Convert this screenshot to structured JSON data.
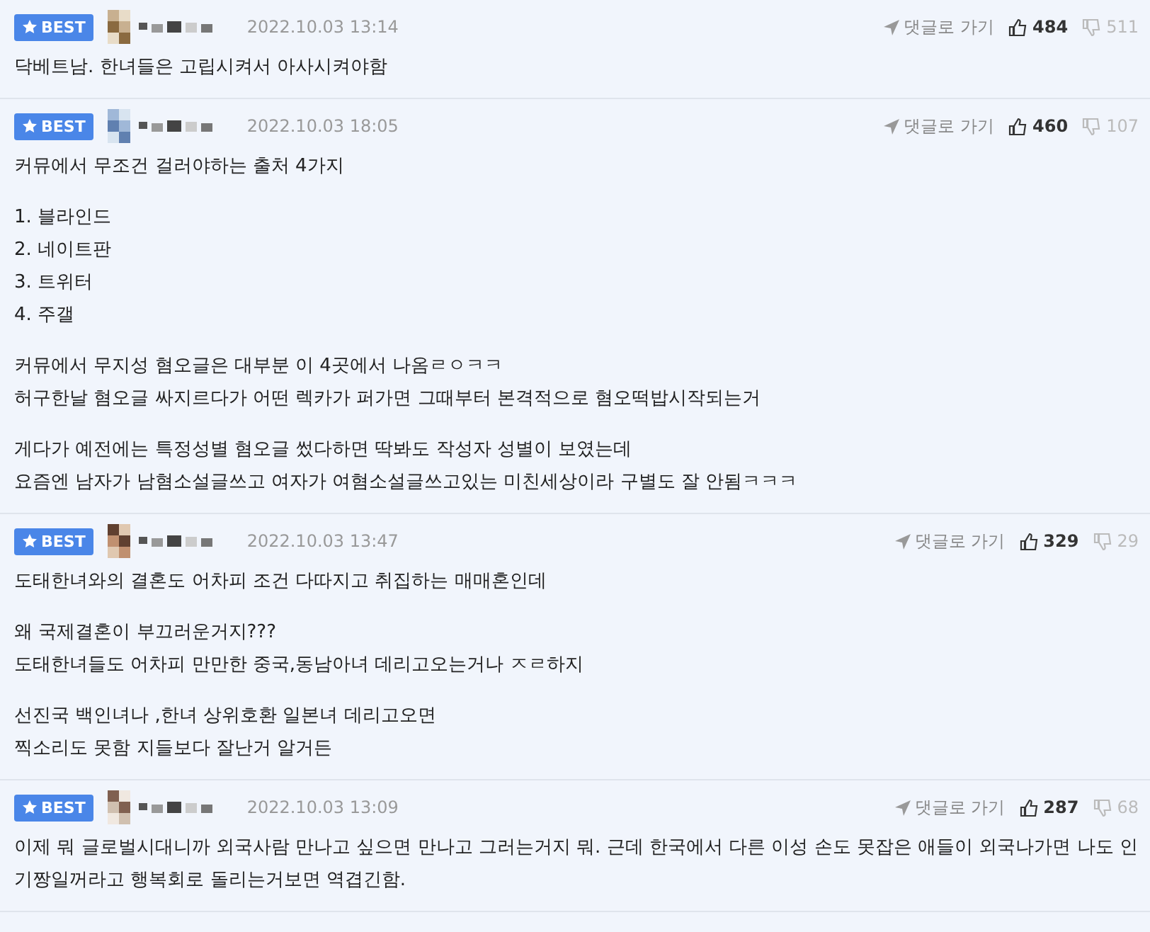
{
  "comments": [
    {
      "badge": "BEST",
      "date": "2022.10.03 13:14",
      "reply_label": "댓글로 가기",
      "likes": "484",
      "dislikes": "511",
      "paragraphs": [
        [
          "닥베트남. 한녀들은 고립시켜서 아사시켜야함"
        ]
      ]
    },
    {
      "badge": "BEST",
      "date": "2022.10.03 18:05",
      "reply_label": "댓글로 가기",
      "likes": "460",
      "dislikes": "107",
      "paragraphs": [
        [
          "커뮤에서 무조건 걸러야하는 출처 4가지"
        ],
        [
          "1. 블라인드",
          "2. 네이트판",
          "3. 트위터",
          "4. 주갤"
        ],
        [
          "커뮤에서 무지성 혐오글은 대부분 이 4곳에서 나옴ㄹㅇㅋㅋ",
          "허구한날 혐오글 싸지르다가 어떤 렉카가 퍼가면 그때부터 본격적으로 혐오떡밥시작되는거"
        ],
        [
          "게다가 예전에는 특정성별 혐오글 썼다하면 딱봐도 작성자 성별이 보였는데",
          "요즘엔 남자가 남혐소설글쓰고 여자가 여혐소설글쓰고있는 미친세상이라 구별도 잘 안됨ㅋㅋㅋ"
        ]
      ]
    },
    {
      "badge": "BEST",
      "date": "2022.10.03 13:47",
      "reply_label": "댓글로 가기",
      "likes": "329",
      "dislikes": "29",
      "paragraphs": [
        [
          "도태한녀와의 결혼도 어차피 조건 다따지고 취집하는 매매혼인데"
        ],
        [
          "왜 국제결혼이 부끄러운거지???",
          "도태한녀들도 어차피 만만한 중국,동남아녀 데리고오는거나 ㅈㄹ하지"
        ],
        [
          "선진국 백인녀나 ,한녀 상위호환 일본녀 데리고오면",
          "찍소리도 못함 지들보다 잘난거 알거든"
        ]
      ]
    },
    {
      "badge": "BEST",
      "date": "2022.10.03 13:09",
      "reply_label": "댓글로 가기",
      "likes": "287",
      "dislikes": "68",
      "paragraphs": [
        [
          "이제 뭐 글로벌시대니까 외국사람 만나고 싶으면 만나고 그러는거지 뭐. 근데 한국에서 다른 이성 손도 못잡은 애들이 외국나가면 나도 인기짱일꺼라고 행복회로 돌리는거보면 역겹긴함."
        ]
      ]
    }
  ]
}
